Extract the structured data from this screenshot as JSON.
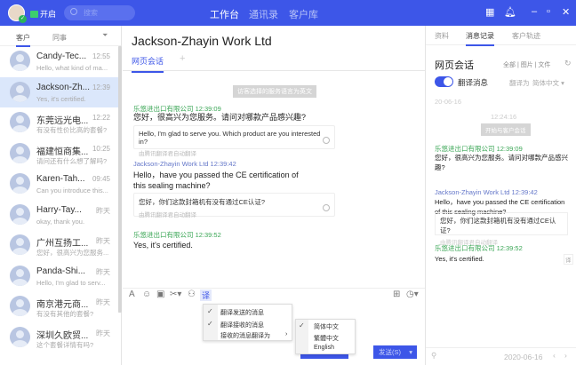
{
  "header": {
    "status": "开启",
    "search_placeholder": "搜索",
    "nav": [
      "工作台",
      "通讯录",
      "客户库"
    ],
    "icons": [
      "apps-icon",
      "bell-icon",
      "minimize-icon",
      "maximize-icon",
      "close-icon"
    ]
  },
  "sidebar": {
    "tabs": [
      "客户",
      "同事"
    ],
    "items": [
      {
        "name": "Candy-Tec...",
        "time": "12:55",
        "preview": "Hello, what kind of ma..."
      },
      {
        "name": "Jackson-Zh...",
        "time": "12:39",
        "preview": "Yes, it's certified."
      },
      {
        "name": "东莞远光电...",
        "time": "12:22",
        "preview": "有没有性价比高的套餐?"
      },
      {
        "name": "福建恒商集...",
        "time": "10:25",
        "preview": "请问还有什么想了解吗?"
      },
      {
        "name": "Karen-Tah...",
        "time": "09:45",
        "preview": "Can you introduce this..."
      },
      {
        "name": "Harry-Tay...",
        "time": "昨天",
        "preview": "okay, thank you."
      },
      {
        "name": "广州互扬工...",
        "time": "昨天",
        "preview": "您好，很高兴为您服务..."
      },
      {
        "name": "Panda-Shi...",
        "time": "昨天",
        "preview": "Hello, I'm glad to serv..."
      },
      {
        "name": "南京港元商...",
        "time": "昨天",
        "preview": "有没有其他的套餐?"
      },
      {
        "name": "深圳久欧贸...",
        "time": "昨天",
        "preview": "这个套餐详情有吗?"
      }
    ]
  },
  "chat": {
    "title": "Jackson-Zhayin Work Ltd",
    "tab": "网页会话",
    "notice": "访客选择的服务语言为英文",
    "messages": [
      {
        "meta": "乐悠进出口有限公司 12:39:09",
        "text": "您好，很高兴为您服务。请问对哪款产品感兴趣?",
        "translation": "Hello, I'm glad to serve you. Which product are you interested in?",
        "by": "由腾讯翻译君自动翻译"
      },
      {
        "meta": "Jackson-Zhayin Work Ltd 12:39:42",
        "text": "Hello，have you passed the CE certification of this sealing machine?",
        "translation": "您好，你们这款封箱机有没有通过CE认证?",
        "by": "由腾讯翻译君自动翻译"
      },
      {
        "meta": "乐悠进出口有限公司 12:39:52",
        "text": "Yes, it's certified."
      }
    ],
    "translate_button": "译",
    "menu": [
      "翻译发送的消息",
      "翻译接收的消息",
      "接收的消息翻译为"
    ],
    "submenu": [
      "简体中文",
      "繁體中文",
      "English"
    ],
    "send_label": "发送(S)"
  },
  "right": {
    "tabs": [
      "资料",
      "消息记录",
      "客户轨迹"
    ],
    "heading": "网页会话",
    "filters": "全部 | 图片 | 文件",
    "toggle_label": "翻译消息",
    "translate_to_label": "翻译为",
    "translate_to": "简体中文",
    "date": "20-06-16",
    "time": "12:24:16",
    "start": "开始与客户会话",
    "messages": [
      {
        "meta": "乐悠进出口有限公司 12:39:09",
        "text": "您好，很高兴为您服务。请问对哪款产品感兴趣?"
      },
      {
        "meta": "Jackson-Zhayin Work Ltd 12:39:42",
        "text": "Hello，have you passed the CE certification of this sealing machine?",
        "translation": "您好，你们这款封箱机有没有通过CE认证?",
        "by": "由腾讯翻译君自动翻译"
      },
      {
        "meta": "乐悠进出口有限公司 12:39:52",
        "text": "Yes, it's certified.",
        "badge": "译"
      }
    ],
    "footer_date": "2020-06-16"
  }
}
